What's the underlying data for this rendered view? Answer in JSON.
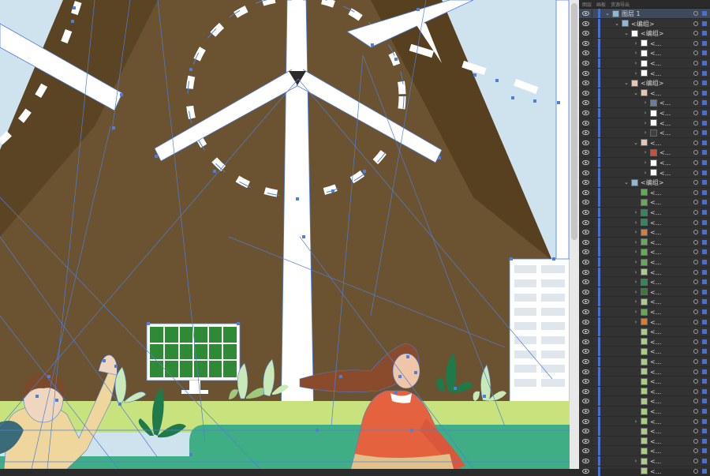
{
  "panel": {
    "tabs": [
      "图层",
      "画板",
      "资源导出"
    ],
    "layers": [
      {
        "label": "图层 1",
        "depth": 0,
        "chev": "v",
        "thumb": "scene",
        "selected": true
      },
      {
        "label": "<编组>",
        "depth": 1,
        "chev": "v",
        "thumb": "scene"
      },
      {
        "label": "<编组>",
        "depth": 2,
        "chev": "v",
        "thumb": "white"
      },
      {
        "label": "<...",
        "depth": 3,
        "chev": ">",
        "thumb": "white"
      },
      {
        "label": "<...",
        "depth": 3,
        "chev": ">",
        "thumb": "white"
      },
      {
        "label": "<...",
        "depth": 3,
        "chev": ">",
        "thumb": "white"
      },
      {
        "label": "<...",
        "depth": 3,
        "chev": ">",
        "thumb": "white"
      },
      {
        "label": "<编组>",
        "depth": 2,
        "chev": "v",
        "thumb": "figure"
      },
      {
        "label": "<...",
        "depth": 3,
        "chev": "v",
        "thumb": "figure"
      },
      {
        "label": "<...",
        "depth": 4,
        "chev": ">",
        "thumb": "tool"
      },
      {
        "label": "<...",
        "depth": 4,
        "chev": ">",
        "thumb": "white"
      },
      {
        "label": "<...",
        "depth": 4,
        "chev": ">",
        "thumb": "white"
      },
      {
        "label": "<...",
        "depth": 4,
        "chev": ">",
        "thumb": "dark"
      },
      {
        "label": "<...",
        "depth": 3,
        "chev": "v",
        "thumb": "figure"
      },
      {
        "label": "<...",
        "depth": 4,
        "chev": ">",
        "thumb": "red"
      },
      {
        "label": "<...",
        "depth": 4,
        "chev": ">",
        "thumb": "white"
      },
      {
        "label": "<...",
        "depth": 4,
        "chev": ">",
        "thumb": "white"
      },
      {
        "label": "<编组>",
        "depth": 2,
        "chev": "v",
        "thumb": "scene"
      },
      {
        "label": "<...",
        "depth": 3,
        "chev": "",
        "thumb": "green"
      },
      {
        "label": "<...",
        "depth": 3,
        "chev": "",
        "thumb": "green"
      },
      {
        "label": "<...",
        "depth": 3,
        "chev": ">",
        "thumb": "hill"
      },
      {
        "label": "<...",
        "depth": 3,
        "chev": ">",
        "thumb": "hill"
      },
      {
        "label": "<...",
        "depth": 3,
        "chev": ">",
        "thumb": "orange"
      },
      {
        "label": "<...",
        "depth": 3,
        "chev": ">",
        "thumb": "green"
      },
      {
        "label": "<...",
        "depth": 3,
        "chev": ">",
        "thumb": "green"
      },
      {
        "label": "<...",
        "depth": 3,
        "chev": ">",
        "thumb": "green"
      },
      {
        "label": "<...",
        "depth": 3,
        "chev": ">",
        "thumb": "leaf"
      },
      {
        "label": "<...",
        "depth": 3,
        "chev": ">",
        "thumb": "hill"
      },
      {
        "label": "<...",
        "depth": 3,
        "chev": ">",
        "thumb": "tree"
      },
      {
        "label": "<...",
        "depth": 3,
        "chev": ">",
        "thumb": "leaf"
      },
      {
        "label": "<...",
        "depth": 3,
        "chev": ">",
        "thumb": "green"
      },
      {
        "label": "<...",
        "depth": 3,
        "chev": ">",
        "thumb": "orange"
      },
      {
        "label": "<...",
        "depth": 3,
        "chev": "",
        "thumb": "leaf"
      },
      {
        "label": "<...",
        "depth": 3,
        "chev": "",
        "thumb": "leaf"
      },
      {
        "label": "<...",
        "depth": 3,
        "chev": "",
        "thumb": "leaf"
      },
      {
        "label": "<...",
        "depth": 3,
        "chev": "",
        "thumb": "leaf"
      },
      {
        "label": "<...",
        "depth": 3,
        "chev": "",
        "thumb": "leaf"
      },
      {
        "label": "<...",
        "depth": 3,
        "chev": "",
        "thumb": "leaf"
      },
      {
        "label": "<...",
        "depth": 3,
        "chev": "",
        "thumb": "leaf"
      },
      {
        "label": "<...",
        "depth": 3,
        "chev": "",
        "thumb": "leaf"
      },
      {
        "label": "<...",
        "depth": 3,
        "chev": "",
        "thumb": "leaf"
      },
      {
        "label": "<...",
        "depth": 3,
        "chev": ">",
        "thumb": "leaf"
      },
      {
        "label": "<...",
        "depth": 3,
        "chev": "",
        "thumb": "leaf"
      },
      {
        "label": "<...",
        "depth": 3,
        "chev": "",
        "thumb": "leaf"
      },
      {
        "label": "<...",
        "depth": 3,
        "chev": "",
        "thumb": "leaf"
      },
      {
        "label": "<...",
        "depth": 3,
        "chev": ">",
        "thumb": "leaf"
      },
      {
        "label": "<...",
        "depth": 3,
        "chev": "",
        "thumb": "leaf"
      }
    ]
  },
  "colors": {
    "sky": "#cfe3ef",
    "mountain": "#6b5230",
    "mountain_shade": "#5b4424",
    "turbine": "#ffffff",
    "grass": "#c8e27d",
    "road": "#3fae84",
    "guide": "#4f7fd8",
    "panel_bg": "#323232",
    "selection": "#4b6fcf"
  },
  "icons": {
    "visibility": "eye-icon",
    "expand": "chevron-icon"
  }
}
